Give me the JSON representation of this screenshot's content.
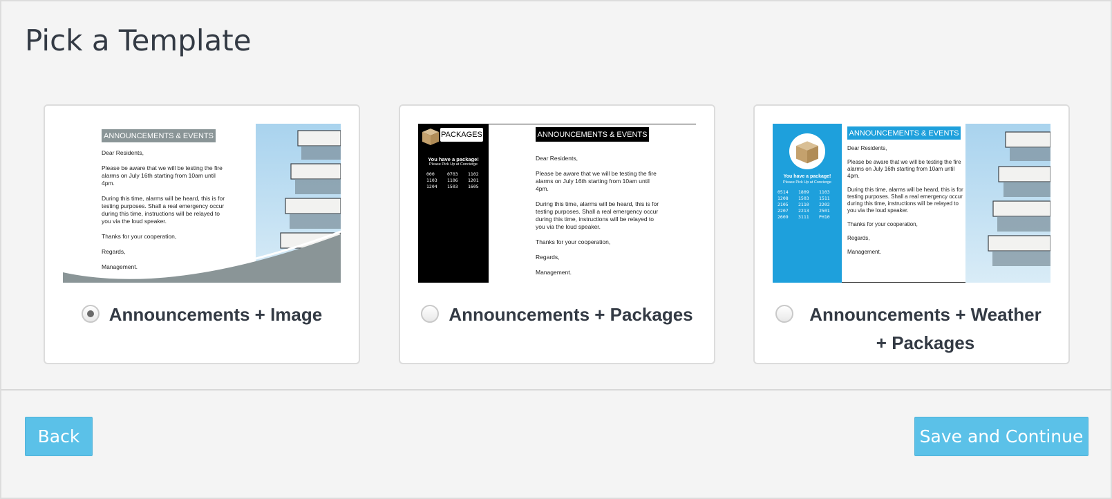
{
  "page": {
    "title": "Pick a Template"
  },
  "templates": [
    {
      "label": "Announcements + Image",
      "selected": true,
      "preview": {
        "header": "ANNOUNCEMENTS & EVENTS",
        "greeting": "Dear Residents,",
        "para1": "Please be aware that we will be testing the fire alarms on July 16th starting from 10am until 4pm.",
        "para2": "During this time, alarms will be heard, this is for testing purposes. Shall a real emergency occur during this time, instructions will be relayed to you via the loud speaker.",
        "thanks": "Thanks for your cooperation,",
        "regards": "Regards,",
        "signoff": "Management."
      }
    },
    {
      "label": "Announcements + Packages",
      "selected": false,
      "preview": {
        "packages_title": "PACKAGES",
        "package_notice": "You have a package!",
        "package_sub": "Please Pick Up at Concierge",
        "codes": [
          "000",
          "0703",
          "1102",
          "1103",
          "1106",
          "1201",
          "1204",
          "1503",
          "1605"
        ],
        "header": "ANNOUNCEMENTS & EVENTS",
        "greeting": "Dear Residents,",
        "para1": "Please be aware that we will be testing the fire alarms on July 16th starting from 10am until 4pm.",
        "para2": "During this time, alarms will be heard, this is for testing purposes. Shall a real emergency occur during this time, instructions will be relayed to you via the loud speaker.",
        "thanks": "Thanks for your cooperation,",
        "regards": "Regards,",
        "signoff": "Management."
      }
    },
    {
      "label": "Announcements + Weather + Packages",
      "selected": false,
      "preview": {
        "package_notice": "You have a package!",
        "package_sub": "Please Pick Up at Concierge",
        "codes": [
          "0514",
          "1809",
          "1103",
          "1208",
          "1503",
          "1511",
          "2105",
          "2110",
          "2202",
          "2207",
          "2213",
          "2501",
          "2609",
          "3111",
          "PH10"
        ],
        "header": "ANNOUNCEMENTS & EVENTS",
        "greeting": "Dear Residents,",
        "para1": "Please be aware that we will be testing the fire alarms on July 16th starting from 10am until 4pm.",
        "para2": "During this time, alarms will be heard, this is for testing purposes. Shall a real emergency occur during this time, instructions will be relayed to you via the loud speaker.",
        "thanks": "Thanks for your cooperation,",
        "regards": "Regards,",
        "signoff": "Management."
      }
    }
  ],
  "buttons": {
    "back": "Back",
    "save": "Save and Continue"
  },
  "colors": {
    "accent": "#5bc1e8",
    "background": "#f4f4f4",
    "preview_blue": "#1ea0dc",
    "preview_gray": "#8a9597"
  }
}
